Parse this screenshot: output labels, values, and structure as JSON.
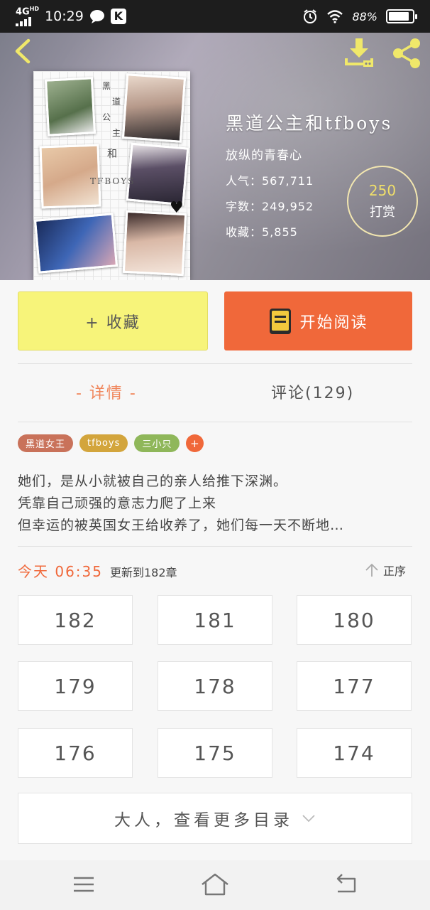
{
  "status_bar": {
    "network": "4G",
    "network_sub": "HD",
    "time": "10:29",
    "battery": "88%",
    "battery_level": 0.88
  },
  "icons": {
    "back": "chevron-left-icon",
    "download": "download-icon",
    "share": "share-icon"
  },
  "book": {
    "title": "黑道公主和tfboys",
    "author": "放纵的青春心",
    "popularity": "人气：567,711",
    "word_count": "字数：249,952",
    "favorites": "收藏：5,855"
  },
  "cover": {
    "text_col1": [
      "黑",
      "道",
      "公",
      "主"
    ],
    "text_col2": "和",
    "name": "TFBOYS"
  },
  "reward": {
    "count": "250",
    "label": "打赏"
  },
  "actions": {
    "collect": "+ 收藏",
    "read": "开始阅读"
  },
  "tabs": {
    "detail": "- 详情 -",
    "comments": "评论(129)"
  },
  "tags": [
    {
      "label": "黑道女王",
      "color": "#c9725a"
    },
    {
      "label": "tfboys",
      "color": "#d3a53c"
    },
    {
      "label": "三小只",
      "color": "#8fb75a"
    },
    {
      "label": "+",
      "color": "#f0683a"
    }
  ],
  "description": [
    "她们，是从小就被自己的亲人给推下深渊。",
    "凭靠自己顽强的意志力爬了上来",
    "但幸运的被英国女王给收养了，她们每一天不断地…"
  ],
  "update": {
    "time": "今天 06:35",
    "text": "更新到182章",
    "order": "正序"
  },
  "chapters": [
    "182",
    "181",
    "180",
    "179",
    "178",
    "177",
    "176",
    "175",
    "174"
  ],
  "more": "大人，查看更多目录",
  "colors": {
    "accent_orange": "#f0683a",
    "accent_yellow": "#f7f47a",
    "header_icon": "#f0e86a"
  }
}
